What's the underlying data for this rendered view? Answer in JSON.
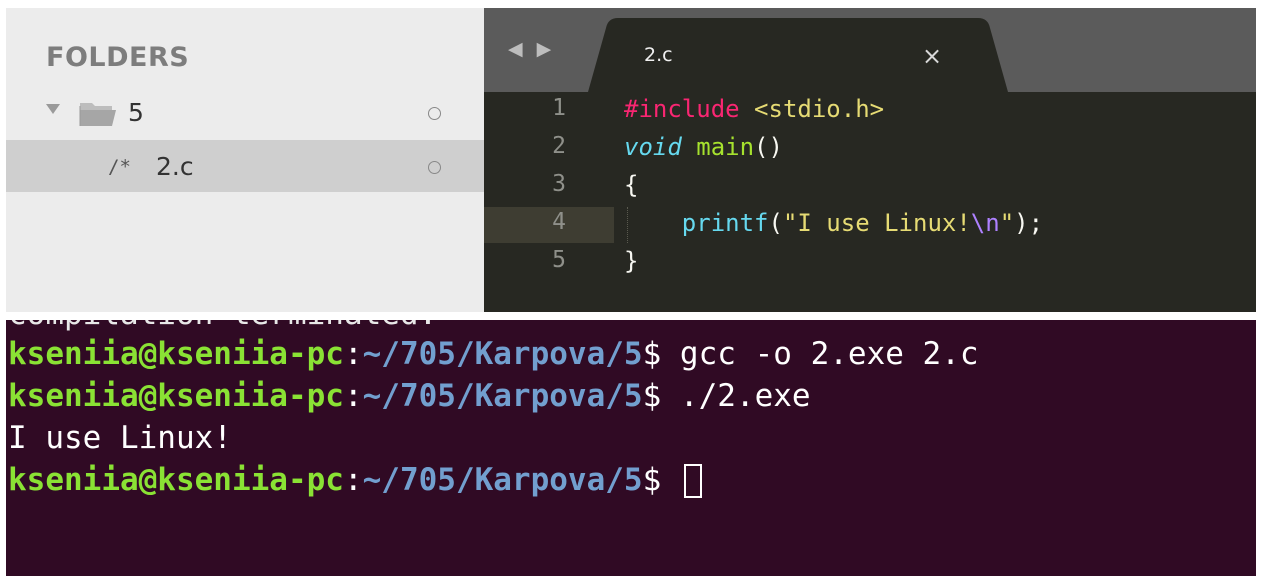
{
  "sidebar": {
    "header": "FOLDERS",
    "folder": {
      "label": "5"
    },
    "file": {
      "type_icon": "/*",
      "label": "2.c"
    }
  },
  "editor": {
    "nav_arrows": "◀ ▶",
    "tab": {
      "title": "2.c",
      "close": "×"
    },
    "current_line": 4,
    "lines": [
      {
        "number": "1",
        "tokens": [
          "#include",
          " ",
          "<stdio.h>"
        ]
      },
      {
        "number": "2",
        "tokens": [
          "void",
          " ",
          "main",
          "()"
        ]
      },
      {
        "number": "3",
        "tokens": [
          "{"
        ]
      },
      {
        "number": "4",
        "tokens": [
          "    ",
          "printf",
          "(",
          "\"I use Linux!",
          "\\n",
          "\"",
          ");"
        ]
      },
      {
        "number": "5",
        "tokens": [
          "}"
        ]
      }
    ]
  },
  "terminal": {
    "cutoff_text": "compilation terminated.",
    "user_host": "kseniia@kseniia-pc",
    "colon": ":",
    "path": "~/705/Karpova/5",
    "dollar": "$",
    "commands": [
      " gcc -o 2.exe 2.c",
      " ./2.exe"
    ],
    "output": "I use Linux!",
    "cursor": "cursor-block"
  },
  "colors": {
    "terminal_bg": "#300a24",
    "prompt_user": "#8ae234",
    "prompt_path": "#729fcf",
    "editor_bg": "#272822",
    "sidebar_bg": "#ececec"
  }
}
